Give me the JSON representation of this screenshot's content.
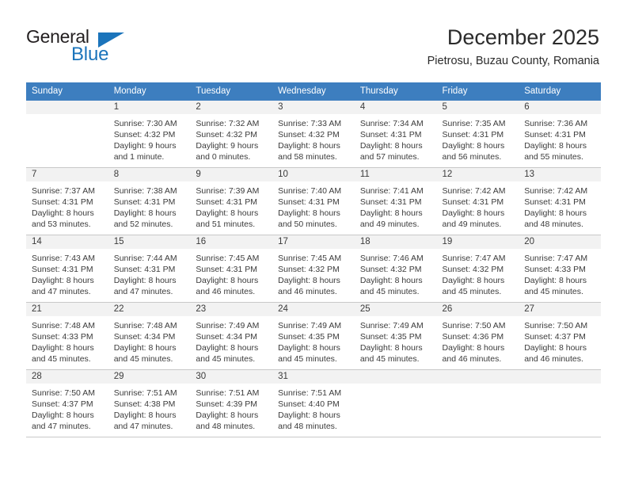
{
  "brand": {
    "name_top": "General",
    "name_bottom": "Blue",
    "color_blue": "#1b74bb",
    "color_dark": "#231f20"
  },
  "header": {
    "title": "December 2025",
    "subtitle": "Pietrosu, Buzau County, Romania"
  },
  "theme": {
    "header_bar": "#3d7ebf",
    "daynum_bg": "#f2f2f2",
    "text": "#3b3b3b",
    "grid_line": "#c8c8c8"
  },
  "labels": {
    "sunrise": "Sunrise:",
    "sunset": "Sunset:",
    "daylight": "Daylight:"
  },
  "weekdays": [
    "Sunday",
    "Monday",
    "Tuesday",
    "Wednesday",
    "Thursday",
    "Friday",
    "Saturday"
  ],
  "weeks": [
    [
      {
        "day": "",
        "empty": true,
        "sunrise": "",
        "sunset": "",
        "daylight_1": "",
        "daylight_2": ""
      },
      {
        "day": "1",
        "sunrise": "Sunrise: 7:30 AM",
        "sunset": "Sunset: 4:32 PM",
        "daylight_1": "Daylight: 9 hours",
        "daylight_2": "and 1 minute."
      },
      {
        "day": "2",
        "sunrise": "Sunrise: 7:32 AM",
        "sunset": "Sunset: 4:32 PM",
        "daylight_1": "Daylight: 9 hours",
        "daylight_2": "and 0 minutes."
      },
      {
        "day": "3",
        "sunrise": "Sunrise: 7:33 AM",
        "sunset": "Sunset: 4:32 PM",
        "daylight_1": "Daylight: 8 hours",
        "daylight_2": "and 58 minutes."
      },
      {
        "day": "4",
        "sunrise": "Sunrise: 7:34 AM",
        "sunset": "Sunset: 4:31 PM",
        "daylight_1": "Daylight: 8 hours",
        "daylight_2": "and 57 minutes."
      },
      {
        "day": "5",
        "sunrise": "Sunrise: 7:35 AM",
        "sunset": "Sunset: 4:31 PM",
        "daylight_1": "Daylight: 8 hours",
        "daylight_2": "and 56 minutes."
      },
      {
        "day": "6",
        "sunrise": "Sunrise: 7:36 AM",
        "sunset": "Sunset: 4:31 PM",
        "daylight_1": "Daylight: 8 hours",
        "daylight_2": "and 55 minutes."
      }
    ],
    [
      {
        "day": "7",
        "sunrise": "Sunrise: 7:37 AM",
        "sunset": "Sunset: 4:31 PM",
        "daylight_1": "Daylight: 8 hours",
        "daylight_2": "and 53 minutes."
      },
      {
        "day": "8",
        "sunrise": "Sunrise: 7:38 AM",
        "sunset": "Sunset: 4:31 PM",
        "daylight_1": "Daylight: 8 hours",
        "daylight_2": "and 52 minutes."
      },
      {
        "day": "9",
        "sunrise": "Sunrise: 7:39 AM",
        "sunset": "Sunset: 4:31 PM",
        "daylight_1": "Daylight: 8 hours",
        "daylight_2": "and 51 minutes."
      },
      {
        "day": "10",
        "sunrise": "Sunrise: 7:40 AM",
        "sunset": "Sunset: 4:31 PM",
        "daylight_1": "Daylight: 8 hours",
        "daylight_2": "and 50 minutes."
      },
      {
        "day": "11",
        "sunrise": "Sunrise: 7:41 AM",
        "sunset": "Sunset: 4:31 PM",
        "daylight_1": "Daylight: 8 hours",
        "daylight_2": "and 49 minutes."
      },
      {
        "day": "12",
        "sunrise": "Sunrise: 7:42 AM",
        "sunset": "Sunset: 4:31 PM",
        "daylight_1": "Daylight: 8 hours",
        "daylight_2": "and 49 minutes."
      },
      {
        "day": "13",
        "sunrise": "Sunrise: 7:42 AM",
        "sunset": "Sunset: 4:31 PM",
        "daylight_1": "Daylight: 8 hours",
        "daylight_2": "and 48 minutes."
      }
    ],
    [
      {
        "day": "14",
        "sunrise": "Sunrise: 7:43 AM",
        "sunset": "Sunset: 4:31 PM",
        "daylight_1": "Daylight: 8 hours",
        "daylight_2": "and 47 minutes."
      },
      {
        "day": "15",
        "sunrise": "Sunrise: 7:44 AM",
        "sunset": "Sunset: 4:31 PM",
        "daylight_1": "Daylight: 8 hours",
        "daylight_2": "and 47 minutes."
      },
      {
        "day": "16",
        "sunrise": "Sunrise: 7:45 AM",
        "sunset": "Sunset: 4:31 PM",
        "daylight_1": "Daylight: 8 hours",
        "daylight_2": "and 46 minutes."
      },
      {
        "day": "17",
        "sunrise": "Sunrise: 7:45 AM",
        "sunset": "Sunset: 4:32 PM",
        "daylight_1": "Daylight: 8 hours",
        "daylight_2": "and 46 minutes."
      },
      {
        "day": "18",
        "sunrise": "Sunrise: 7:46 AM",
        "sunset": "Sunset: 4:32 PM",
        "daylight_1": "Daylight: 8 hours",
        "daylight_2": "and 45 minutes."
      },
      {
        "day": "19",
        "sunrise": "Sunrise: 7:47 AM",
        "sunset": "Sunset: 4:32 PM",
        "daylight_1": "Daylight: 8 hours",
        "daylight_2": "and 45 minutes."
      },
      {
        "day": "20",
        "sunrise": "Sunrise: 7:47 AM",
        "sunset": "Sunset: 4:33 PM",
        "daylight_1": "Daylight: 8 hours",
        "daylight_2": "and 45 minutes."
      }
    ],
    [
      {
        "day": "21",
        "sunrise": "Sunrise: 7:48 AM",
        "sunset": "Sunset: 4:33 PM",
        "daylight_1": "Daylight: 8 hours",
        "daylight_2": "and 45 minutes."
      },
      {
        "day": "22",
        "sunrise": "Sunrise: 7:48 AM",
        "sunset": "Sunset: 4:34 PM",
        "daylight_1": "Daylight: 8 hours",
        "daylight_2": "and 45 minutes."
      },
      {
        "day": "23",
        "sunrise": "Sunrise: 7:49 AM",
        "sunset": "Sunset: 4:34 PM",
        "daylight_1": "Daylight: 8 hours",
        "daylight_2": "and 45 minutes."
      },
      {
        "day": "24",
        "sunrise": "Sunrise: 7:49 AM",
        "sunset": "Sunset: 4:35 PM",
        "daylight_1": "Daylight: 8 hours",
        "daylight_2": "and 45 minutes."
      },
      {
        "day": "25",
        "sunrise": "Sunrise: 7:49 AM",
        "sunset": "Sunset: 4:35 PM",
        "daylight_1": "Daylight: 8 hours",
        "daylight_2": "and 45 minutes."
      },
      {
        "day": "26",
        "sunrise": "Sunrise: 7:50 AM",
        "sunset": "Sunset: 4:36 PM",
        "daylight_1": "Daylight: 8 hours",
        "daylight_2": "and 46 minutes."
      },
      {
        "day": "27",
        "sunrise": "Sunrise: 7:50 AM",
        "sunset": "Sunset: 4:37 PM",
        "daylight_1": "Daylight: 8 hours",
        "daylight_2": "and 46 minutes."
      }
    ],
    [
      {
        "day": "28",
        "sunrise": "Sunrise: 7:50 AM",
        "sunset": "Sunset: 4:37 PM",
        "daylight_1": "Daylight: 8 hours",
        "daylight_2": "and 47 minutes."
      },
      {
        "day": "29",
        "sunrise": "Sunrise: 7:51 AM",
        "sunset": "Sunset: 4:38 PM",
        "daylight_1": "Daylight: 8 hours",
        "daylight_2": "and 47 minutes."
      },
      {
        "day": "30",
        "sunrise": "Sunrise: 7:51 AM",
        "sunset": "Sunset: 4:39 PM",
        "daylight_1": "Daylight: 8 hours",
        "daylight_2": "and 48 minutes."
      },
      {
        "day": "31",
        "sunrise": "Sunrise: 7:51 AM",
        "sunset": "Sunset: 4:40 PM",
        "daylight_1": "Daylight: 8 hours",
        "daylight_2": "and 48 minutes."
      },
      {
        "day": "",
        "empty": true,
        "sunrise": "",
        "sunset": "",
        "daylight_1": "",
        "daylight_2": ""
      },
      {
        "day": "",
        "empty": true,
        "sunrise": "",
        "sunset": "",
        "daylight_1": "",
        "daylight_2": ""
      },
      {
        "day": "",
        "empty": true,
        "sunrise": "",
        "sunset": "",
        "daylight_1": "",
        "daylight_2": ""
      }
    ]
  ]
}
